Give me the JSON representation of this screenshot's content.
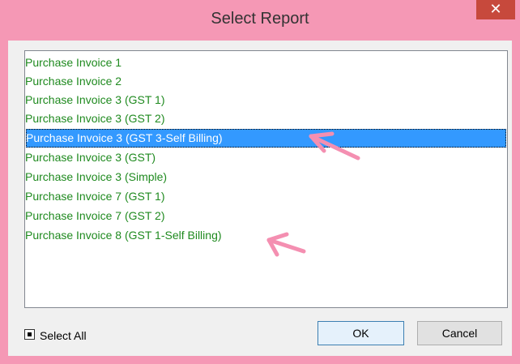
{
  "window": {
    "title": "Select Report",
    "close_label": "✕"
  },
  "report_list": {
    "items": [
      "Purchase Invoice 1",
      "Purchase Invoice 2",
      "Purchase Invoice 3 (GST 1)",
      "Purchase Invoice 3 (GST 2)",
      "Purchase Invoice 3 (GST 3-Self Billing)",
      "Purchase Invoice 3 (GST)",
      "Purchase Invoice 3 (Simple)",
      "Purchase Invoice 7 (GST 1)",
      "Purchase Invoice 7 (GST 2)",
      "Purchase Invoice 8 (GST 1-Self Billing)"
    ],
    "selected_index": 4
  },
  "select_all": {
    "label": "Select All",
    "state": "indeterminate"
  },
  "buttons": {
    "ok": "OK",
    "cancel": "Cancel"
  },
  "colors": {
    "frame": "#f598b5",
    "item_text": "#1f8a1f",
    "selection": "#3399ff",
    "annotation_arrow": "#f48fb1"
  }
}
